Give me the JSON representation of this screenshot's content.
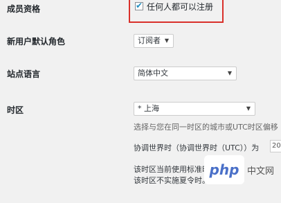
{
  "membership": {
    "label": "成员资格",
    "checkbox_label": "任何人都可以注册",
    "checked": true
  },
  "default_role": {
    "label": "新用户默认角色",
    "selected": "订阅者"
  },
  "site_language": {
    "label": "站点语言",
    "selected": "简体中文"
  },
  "timezone": {
    "label": "时区",
    "selected": "* 上海",
    "hint": "选择与您在同一时区的城市或UTC时区偏移",
    "utc_label": "协调世界时（协调世界时（UTC））为",
    "utc_value": "20",
    "note_standard": "该时区当前使用标准时间。",
    "note_no_dst": "该时区不实施夏令时。"
  },
  "watermark": {
    "logo": "php",
    "text": "中文网"
  },
  "colors": {
    "highlight": "#d9302a",
    "accent": "#1e8cbe"
  }
}
